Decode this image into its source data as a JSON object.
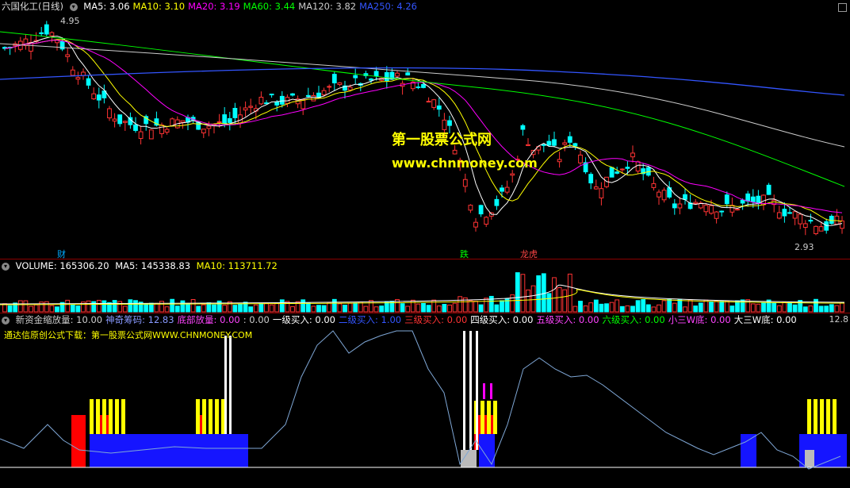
{
  "price_panel": {
    "title": "六国化工(日线)",
    "ma": [
      {
        "label": "MA5: 3.06",
        "color": "#ffffff"
      },
      {
        "label": "MA10: 3.10",
        "color": "#ffff00"
      },
      {
        "label": "MA20: 3.19",
        "color": "#ff00ff"
      },
      {
        "label": "MA60: 3.44",
        "color": "#00ff00"
      },
      {
        "label": "MA120: 3.82",
        "color": "#cccccc"
      },
      {
        "label": "MA250: 4.26",
        "color": "#3355ff"
      }
    ],
    "high_label": "4.95",
    "low_label": "2.93",
    "markers": {
      "cai": "财",
      "die": "跌",
      "longhu": "龙虎"
    },
    "watermark_cn": "第一股票公式网",
    "watermark_en": "www.chnmoney.com"
  },
  "volume_panel": {
    "label": "VOLUME: 165306.20",
    "ma5": "MA5: 145338.83",
    "ma10": "MA10: 113711.72"
  },
  "indicator_panel": {
    "items": [
      {
        "label": "新资金缩放量: 10.00",
        "color": "#cccccc"
      },
      {
        "label": "神奇筹码: 12.83",
        "color": "#8899ff"
      },
      {
        "label": "底部放量: 0.00",
        "color": "#ff44ff"
      },
      {
        "label": ": 0.00",
        "color": "#cccccc"
      },
      {
        "label": "一级买入: 0.00",
        "color": "#ffffff"
      },
      {
        "label": "二级买入: 1.00",
        "color": "#3355ff"
      },
      {
        "label": "三级买入: 0.00",
        "color": "#ff3333"
      },
      {
        "label": "四级买入: 0.00",
        "color": "#ffffff"
      },
      {
        "label": "五级买入: 0.00",
        "color": "#ff44ff"
      },
      {
        "label": "六级买入: 0.00",
        "color": "#00ff00"
      },
      {
        "label": "小三W底: 0.00",
        "color": "#ff44ff"
      },
      {
        "label": "大三W底: 0.00",
        "color": "#ffffff"
      }
    ],
    "right_value": "12.8",
    "source_line": "通达信原创公式下载：第一股票公式网WWW.CHNMONEY.COM"
  },
  "chart_data": {
    "type": "candlestick",
    "stock": "六国化工",
    "period": "日线",
    "ylim": [
      2.85,
      5.0
    ],
    "high": 4.95,
    "low": 2.93,
    "ma_last": {
      "MA5": 3.06,
      "MA10": 3.1,
      "MA20": 3.19,
      "MA60": 3.44,
      "MA120": 3.82,
      "MA250": 4.26
    },
    "volume_last": 165306.2,
    "volume_ma5": 145338.83,
    "volume_ma10": 113711.72
  }
}
